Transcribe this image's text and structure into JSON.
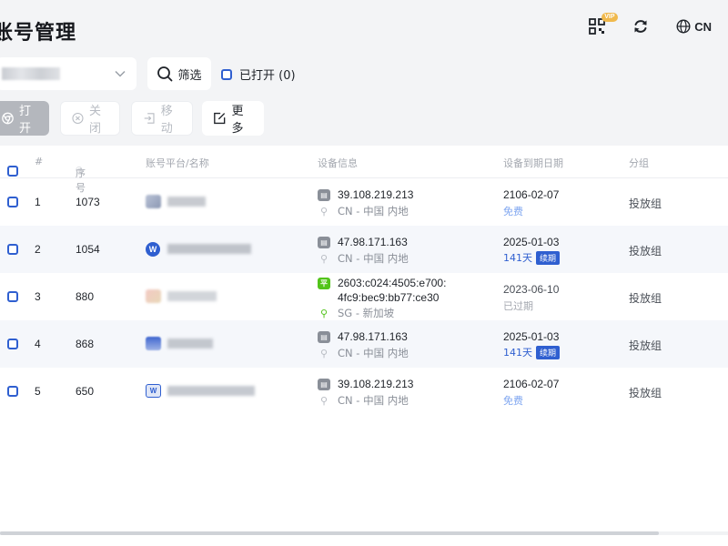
{
  "header": {
    "title": "账号管理",
    "vip_badge": "VIP",
    "language": "CN",
    "icons": [
      "qr-code-icon",
      "refresh-icon",
      "globe-icon"
    ]
  },
  "toolbar": {
    "filter_label": "筛选",
    "opened_label": "已打开 (0)",
    "actions": {
      "open": "打开",
      "close": "关闭",
      "move": "移动",
      "more": "更多"
    }
  },
  "table": {
    "columns": {
      "idx": "#",
      "seq": "序号",
      "platform": "账号平台/名称",
      "device": "设备信息",
      "expiry": "设备到期日期",
      "group": "分组"
    },
    "rows": [
      {
        "idx": "1",
        "seq": "1073",
        "ip": "39.108.219.213",
        "ip2": "",
        "location": "CN - 中国 内地",
        "expiry_date": "2106-02-07",
        "expiry_sub": "免费",
        "renew": "",
        "group": "投放组"
      },
      {
        "idx": "2",
        "seq": "1054",
        "ip": "47.98.171.163",
        "ip2": "",
        "location": "CN - 中国 内地",
        "expiry_date": "2025-01-03",
        "expiry_sub": "141天",
        "renew": "续期",
        "group": "投放组"
      },
      {
        "idx": "3",
        "seq": "880",
        "ip": "2603:c024:4505:e700:",
        "ip2": "4fc9:bec9:bb77:ce30",
        "location": "SG - 新加坡",
        "expiry_date": "2023-06-10",
        "expiry_sub": "已过期",
        "renew": "",
        "group": "投放组"
      },
      {
        "idx": "4",
        "seq": "868",
        "ip": "47.98.171.163",
        "ip2": "",
        "location": "CN - 中国 内地",
        "expiry_date": "2025-01-03",
        "expiry_sub": "141天",
        "renew": "续期",
        "group": "投放组"
      },
      {
        "idx": "5",
        "seq": "650",
        "ip": "39.108.219.213",
        "ip2": "",
        "location": "CN - 中国 内地",
        "expiry_date": "2106-02-07",
        "expiry_sub": "免费",
        "renew": "",
        "group": "投放组"
      }
    ],
    "device_badge": "平"
  },
  "colors": {
    "accent": "#2f5fd0",
    "free_text": "#7fa6f0",
    "expired_text": "#a4a8b0",
    "gray_badge": "#8a8f98",
    "green_badge": "#52c41a"
  }
}
